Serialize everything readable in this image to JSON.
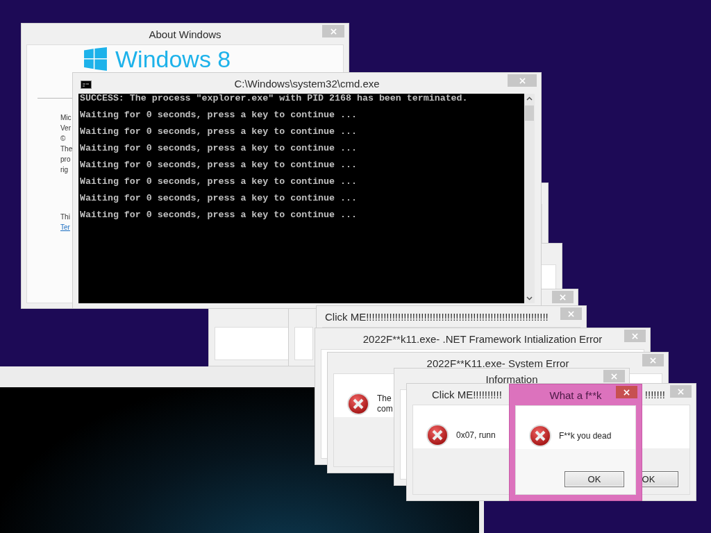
{
  "about_window": {
    "title": "About Windows",
    "logo_text": "Windows 8",
    "info_lines": [
      "Mic",
      "Ver",
      "©",
      "The",
      "pro",
      "rig"
    ],
    "notice_line": "Thi",
    "terms_link": "Ter"
  },
  "console_window": {
    "title": "C:\\Windows\\system32\\cmd.exe",
    "output_lines": [
      "SUCCESS: The process \"explorer.exe\" with PID 2168 has been terminated.",
      "Waiting for 0 seconds, press a key to continue ...",
      "Waiting for 0 seconds, press a key to continue ...",
      "Waiting for 0 seconds, press a key to continue ...",
      "Waiting for 0 seconds, press a key to continue ...",
      "Waiting for 0 seconds, press a key to continue ...",
      "Waiting for 0 seconds, press a key to continue ...",
      "Waiting for 0 seconds, press a key to continue ..."
    ]
  },
  "dialogs": [
    {
      "kind": "plain",
      "title": "Click ME!!!!!!!!!!!!!!!!!!!!!!!!!!!!!!!!!!!!!!!!!!!!!!!!!!!!!!!!!!!!!!!",
      "active": false
    },
    {
      "kind": "plain",
      "title": "2022F**k11.exe- .NET Framework Intialization Error",
      "active": false
    },
    {
      "kind": "error",
      "title": "2022F**K11.exe- System Error",
      "message_lines": [
        "The",
        "com"
      ],
      "active": false
    },
    {
      "kind": "plain",
      "title": "Information",
      "active": false
    },
    {
      "kind": "error",
      "title": "What a f**k",
      "message_lines": [
        "F**k you dead"
      ],
      "button": "OK",
      "active": true
    },
    {
      "kind": "error",
      "title": "Click ME!!!!!!!!!!",
      "title_tail": "!!!!!!!",
      "message_lines": [
        "0x07, runn"
      ],
      "button": "OK",
      "active": false
    }
  ]
}
